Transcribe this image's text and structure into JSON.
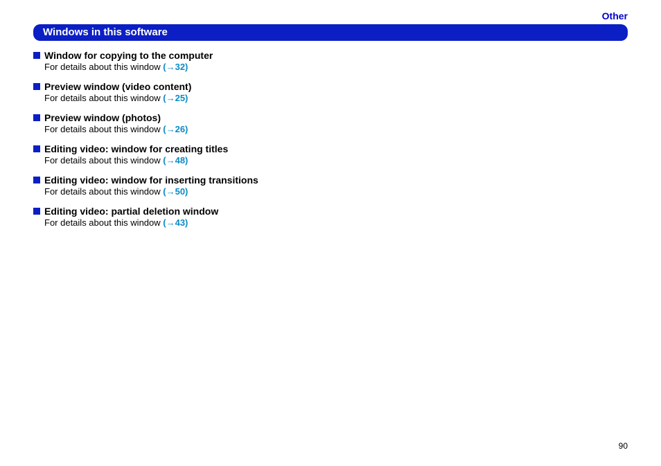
{
  "header": {
    "category": "Other",
    "title": "Windows in this software"
  },
  "detail_prefix": "For details about this window ",
  "items": [
    {
      "title": "Window for copying to the computer",
      "link": "(→32)"
    },
    {
      "title": "Preview window (video content)",
      "link": "(→25)"
    },
    {
      "title": "Preview window (photos)",
      "link": "(→26)"
    },
    {
      "title": "Editing video: window for creating titles",
      "link": "(→48)"
    },
    {
      "title": "Editing video: window for inserting transitions",
      "link": "(→50)"
    },
    {
      "title": "Editing video: partial deletion window",
      "link": "(→43)"
    }
  ],
  "page_number": "90"
}
